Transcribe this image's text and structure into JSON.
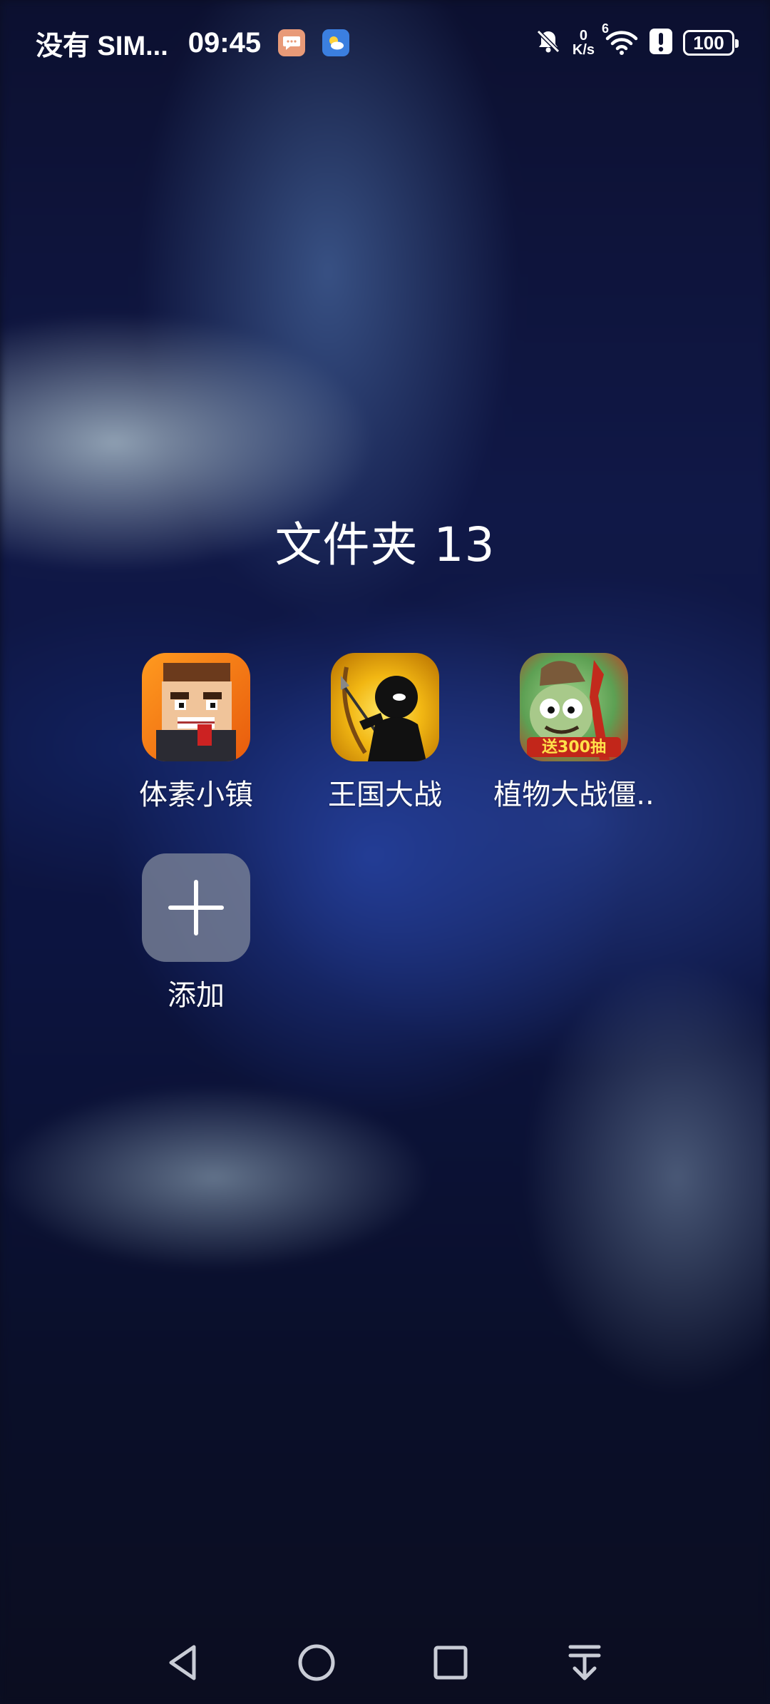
{
  "status_bar": {
    "carrier": "没有 SIM...",
    "time": "09:45",
    "net_speed_value": "0",
    "net_speed_unit": "K/s",
    "signal_label": "6",
    "battery": "100",
    "icons": [
      "message-notification-icon",
      "weather-notification-icon",
      "mute-icon",
      "wifi-icon",
      "alert-icon",
      "battery-icon"
    ]
  },
  "folder": {
    "title": "文件夹 13",
    "apps": [
      {
        "label": "体素小镇",
        "icon": "voxel-town-app-icon",
        "color": "#f07a13"
      },
      {
        "label": "王国大战",
        "icon": "kingdom-war-app-icon",
        "color": "#f2b713"
      },
      {
        "label": "植物大战僵..",
        "icon": "plants-vs-zombies-app-icon",
        "color": "#5da053",
        "badge": "送300抽"
      }
    ],
    "add_label": "添加"
  },
  "navigation": {
    "buttons": [
      "back-icon",
      "home-icon",
      "recents-icon",
      "collapse-down-icon"
    ]
  }
}
